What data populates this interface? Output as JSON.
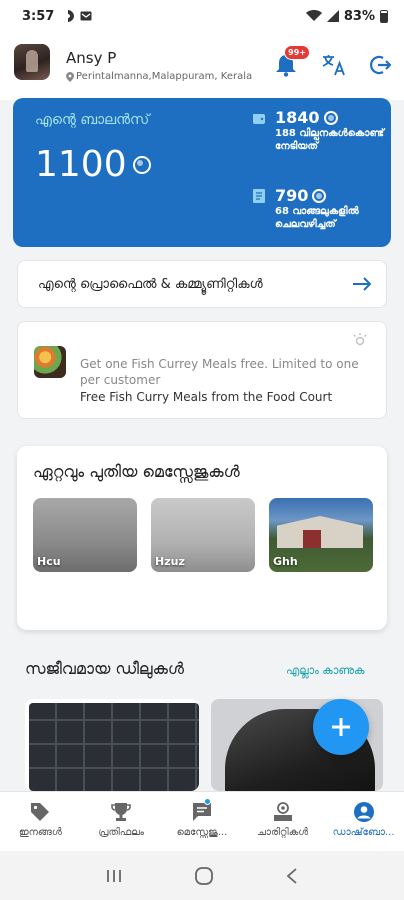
{
  "status_bar": {
    "time": "3:57",
    "battery": "83%"
  },
  "header": {
    "user_name": "Ansy P",
    "location": "Perintalmanna,Malappuram, Kerala",
    "notifications_badge": "99+"
  },
  "balance": {
    "title": "എന്റെ ബാലൻസ്",
    "amount": "1100",
    "earned_value": "1840",
    "earned_desc": "188 വില്പനകൾകൊണ്ട് നേടിയത്",
    "spent_value": "790",
    "spent_desc": "68 വാങ്ങലുകളിൽ ചെലവഴിച്ചത്"
  },
  "profile_link": {
    "label": "എന്റെ പ്രൊഫൈൽ & കമ്മ്യൂണിറ്റികൾ"
  },
  "promo": {
    "title": "Get one Fish Currey Meals free. Limited to one per customer",
    "subtitle": "Free Fish Curry Meals from the Food Court"
  },
  "messages": {
    "title": "ഏറ്റവും പുതിയ മെസ്സേജുകൾ",
    "items": [
      {
        "label": "Hcu"
      },
      {
        "label": "Hzuz"
      },
      {
        "label": "Ghh"
      }
    ]
  },
  "deals": {
    "title": "സജീവമായ ഡീലുകൾ",
    "view_all": "എല്ലാം കാണുക"
  },
  "bottom_nav": [
    {
      "label": "ഇനങ്ങൾ",
      "icon": "tag-icon"
    },
    {
      "label": "പ്രതിഫലം",
      "icon": "trophy-icon"
    },
    {
      "label": "മെസ്സേജു...",
      "icon": "chat-icon"
    },
    {
      "label": "ചാരിറ്റികൾ",
      "icon": "charity-icon"
    },
    {
      "label": "ഡാഷ്‌ബോ...",
      "icon": "account-icon"
    }
  ],
  "colors": {
    "primary": "#1e6fc1",
    "accent_teal": "#1aa2a8",
    "fab": "#2196f3",
    "badge": "#e53935"
  }
}
